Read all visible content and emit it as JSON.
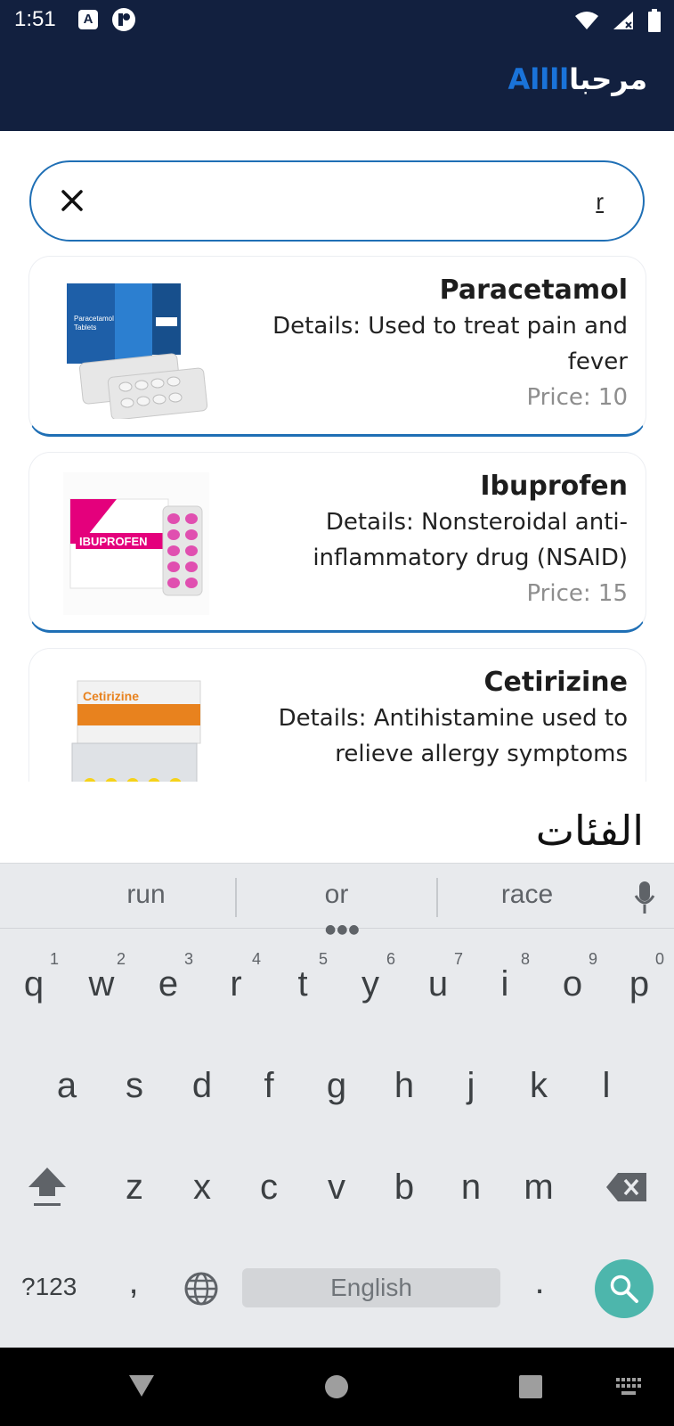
{
  "status_bar": {
    "time": "1:51",
    "icon_a": "A"
  },
  "header": {
    "greeting": "مرحبا",
    "username": "Allll"
  },
  "search": {
    "value": "r",
    "placeholder": ""
  },
  "results": [
    {
      "name": "Paracetamol",
      "details": "Details: Used to treat pain and fever",
      "price": "Price: 10",
      "image_label": "Paracetamol Tablets 500"
    },
    {
      "name": "Ibuprofen",
      "details": "Details: Nonsteroidal anti-inflammatory drug (NSAID)",
      "price": "Price: 15",
      "image_label": "IBUPROFEN"
    },
    {
      "name": "Cetirizine",
      "details": "Details: Antihistamine used to relieve allergy symptoms",
      "price": "",
      "image_label": "Cetirizine"
    }
  ],
  "categories_title": "الفئات",
  "keyboard": {
    "suggestions": [
      "run",
      "or",
      "race"
    ],
    "row1": [
      "q",
      "w",
      "e",
      "r",
      "t",
      "y",
      "u",
      "i",
      "o",
      "p"
    ],
    "row1_hints": [
      "1",
      "2",
      "3",
      "4",
      "5",
      "6",
      "7",
      "8",
      "9",
      "0"
    ],
    "row2": [
      "a",
      "s",
      "d",
      "f",
      "g",
      "h",
      "j",
      "k",
      "l"
    ],
    "row3": [
      "z",
      "x",
      "c",
      "v",
      "b",
      "n",
      "m"
    ],
    "symbols_key": "?123",
    "comma_key": ",",
    "period_key": ".",
    "space_label": "English"
  },
  "colors": {
    "app_bar": "#12203f",
    "accent": "#1f6fb5",
    "username": "#1a73d9",
    "search_key": "#4db6ac"
  }
}
